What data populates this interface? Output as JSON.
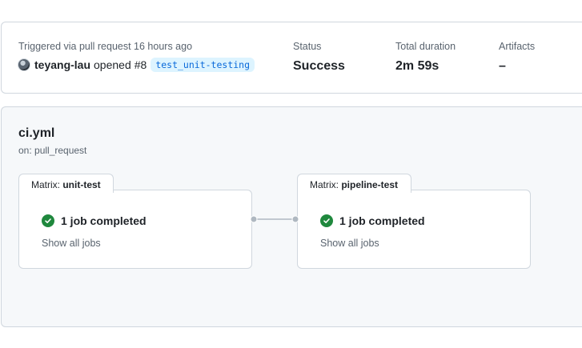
{
  "summary": {
    "triggered_text": "Triggered via pull request 16 hours ago",
    "actor": "teyang-lau",
    "action": "opened",
    "pr_number": "#8",
    "branch": "test_unit-testing",
    "status_label": "Status",
    "status_value": "Success",
    "duration_label": "Total duration",
    "duration_value": "2m 59s",
    "artifacts_label": "Artifacts",
    "artifacts_value": "–"
  },
  "workflow": {
    "name": "ci.yml",
    "trigger": "on: pull_request",
    "matrices": [
      {
        "prefix": "Matrix: ",
        "name": "unit-test",
        "jobs_text": "1 job completed",
        "show_jobs": "Show all jobs"
      },
      {
        "prefix": "Matrix: ",
        "name": "pipeline-test",
        "jobs_text": "1 job completed",
        "show_jobs": "Show all jobs"
      }
    ]
  },
  "colors": {
    "success": "#1f883d",
    "branch_bg": "#ddf4ff",
    "branch_fg": "#0969da"
  }
}
